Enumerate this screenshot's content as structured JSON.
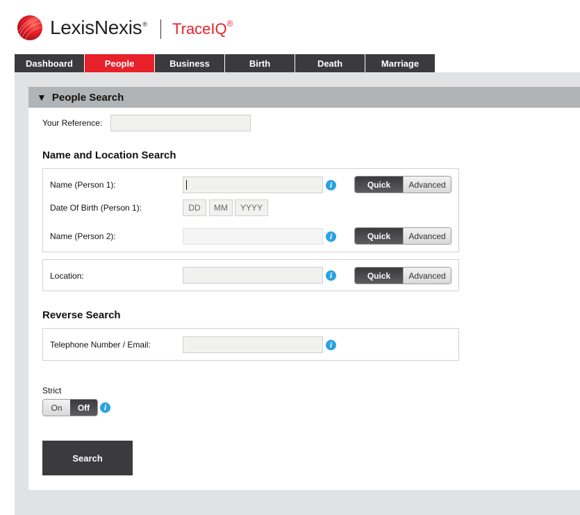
{
  "brand": {
    "company": "LexisNexis",
    "company_mark": "®",
    "product": "TraceIQ",
    "product_mark": "®",
    "accent_color": "#e8202a"
  },
  "nav": {
    "tabs": [
      {
        "label": "Dashboard",
        "active": false
      },
      {
        "label": "People",
        "active": true
      },
      {
        "label": "Business",
        "active": false
      },
      {
        "label": "Birth",
        "active": false
      },
      {
        "label": "Death",
        "active": false
      },
      {
        "label": "Marriage",
        "active": false
      }
    ]
  },
  "panel": {
    "title": "People Search",
    "expand_icon": "triangle-down-icon",
    "reference": {
      "label": "Your Reference:",
      "value": ""
    },
    "name_location": {
      "title": "Name and Location Search",
      "person1": {
        "label": "Name (Person 1):",
        "value": ""
      },
      "dob": {
        "label": "Date Of Birth (Person 1):",
        "dd_placeholder": "DD",
        "mm_placeholder": "MM",
        "yyyy_placeholder": "YYYY"
      },
      "person2": {
        "label": "Name (Person 2):",
        "value": ""
      },
      "location": {
        "label": "Location:",
        "value": ""
      },
      "mode_quick": "Quick",
      "mode_advanced": "Advanced",
      "selected_mode": "Quick"
    },
    "reverse": {
      "title": "Reverse Search",
      "phone_email": {
        "label": "Telephone Number / Email:",
        "value": ""
      }
    },
    "strict": {
      "label": "Strict",
      "on_label": "On",
      "off_label": "Off",
      "selected": "Off"
    },
    "info_icon": "i",
    "search_button": "Search"
  }
}
